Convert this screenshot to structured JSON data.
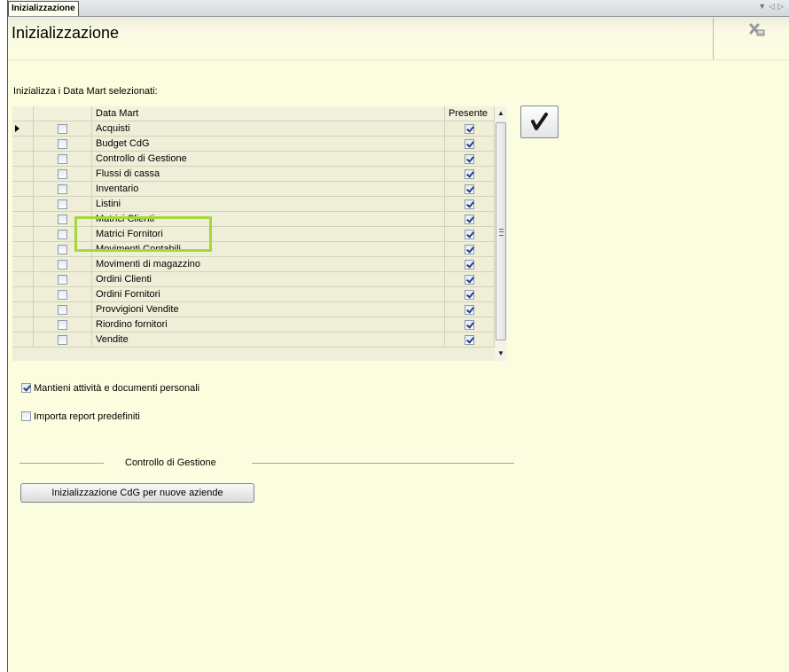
{
  "tabs": {
    "active_label": "Inizializzazione"
  },
  "header": {
    "title": "Inizializzazione"
  },
  "instruction": "Inizializza i Data Mart selezionati:",
  "grid": {
    "columns": {
      "data_mart": "Data Mart",
      "presente": "Presente"
    },
    "rows": [
      {
        "name": "Acquisti",
        "selected": false,
        "present": true,
        "current": true
      },
      {
        "name": "Budget CdG",
        "selected": false,
        "present": true,
        "current": false
      },
      {
        "name": "Controllo di Gestione",
        "selected": false,
        "present": true,
        "current": false
      },
      {
        "name": "Flussi di cassa",
        "selected": false,
        "present": true,
        "current": false
      },
      {
        "name": "Inventario",
        "selected": false,
        "present": true,
        "current": false
      },
      {
        "name": "Listini",
        "selected": false,
        "present": true,
        "current": false
      },
      {
        "name": "Matrici Clienti",
        "selected": false,
        "present": true,
        "current": false
      },
      {
        "name": "Matrici Fornitori",
        "selected": false,
        "present": true,
        "current": false
      },
      {
        "name": "Movimenti Contabili",
        "selected": false,
        "present": true,
        "current": false
      },
      {
        "name": "Movimenti di magazzino",
        "selected": false,
        "present": true,
        "current": false
      },
      {
        "name": "Ordini Clienti",
        "selected": false,
        "present": true,
        "current": false
      },
      {
        "name": "Ordini Fornitori",
        "selected": false,
        "present": true,
        "current": false
      },
      {
        "name": "Provvigioni Vendite",
        "selected": false,
        "present": true,
        "current": false
      },
      {
        "name": "Riordino fornitori",
        "selected": false,
        "present": true,
        "current": false
      },
      {
        "name": "Vendite",
        "selected": false,
        "present": true,
        "current": false
      }
    ]
  },
  "options": {
    "keep_activities": {
      "label": "Mantieni attività e documenti personali",
      "checked": true
    },
    "import_reports": {
      "label": "Importa report predefiniti",
      "checked": false
    }
  },
  "cdg_group": {
    "title": "Controllo di Gestione",
    "button_label": "Inizializzazione CdG per nuove aziende"
  },
  "colors": {
    "background": "#fcfcde",
    "highlight": "#a6d63a",
    "check": "#263c87"
  },
  "icons": {
    "confirm": "checkmark-icon",
    "close": "close-x-icon",
    "current_row": "row-pointer-icon"
  }
}
